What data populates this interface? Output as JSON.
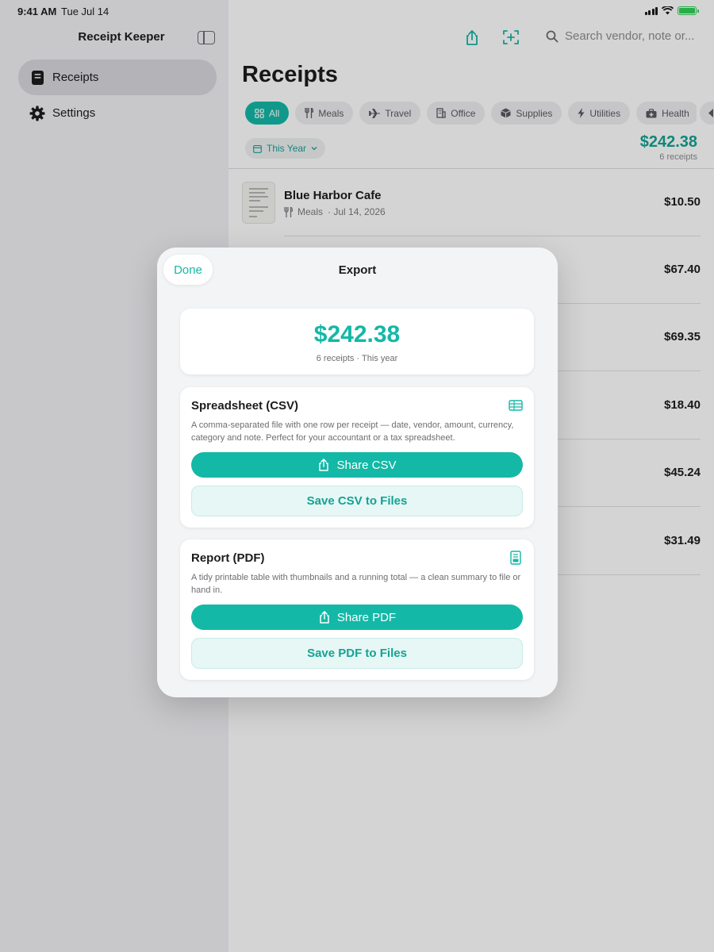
{
  "status": {
    "time": "9:41 AM",
    "date": "Tue Jul 14"
  },
  "sidebar": {
    "title": "Receipt Keeper",
    "items": [
      {
        "label": "Receipts",
        "icon": "receipt-icon",
        "active": true
      },
      {
        "label": "Settings",
        "icon": "gear-icon",
        "active": false
      }
    ]
  },
  "toolbar": {
    "search_placeholder": "Search vendor, note or..."
  },
  "main": {
    "title": "Receipts",
    "filters": [
      "All",
      "Meals",
      "Travel",
      "Office",
      "Supplies",
      "Utilities",
      "Health"
    ],
    "period": "This Year",
    "total": "$242.38",
    "total_count": "6 receipts",
    "receipts": [
      {
        "vendor": "Blue Harbor Cafe",
        "category": "Meals",
        "date": "· Jul 14, 2026",
        "amount": "$10.50"
      },
      {
        "vendor": "",
        "category": "",
        "date": "",
        "amount": "$67.40"
      },
      {
        "vendor": "",
        "category": "",
        "date": "",
        "amount": "$69.35"
      },
      {
        "vendor": "",
        "category": "",
        "date": "",
        "amount": "$18.40"
      },
      {
        "vendor": "",
        "category": "",
        "date": "",
        "amount": "$45.24"
      },
      {
        "vendor": "",
        "category": "",
        "date": "",
        "amount": "$31.49"
      }
    ]
  },
  "export_sheet": {
    "done_label": "Done",
    "title": "Export",
    "summary": {
      "amount": "$242.38",
      "subtitle": "6 receipts · This year"
    },
    "csv": {
      "title": "Spreadsheet (CSV)",
      "description": "A comma-separated file with one row per receipt — date, vendor, amount, currency, category and note. Perfect for your accountant or a tax spreadsheet.",
      "share_label": "Share CSV",
      "save_label": "Save CSV to Files"
    },
    "pdf": {
      "title": "Report (PDF)",
      "description": "A tidy printable table with thumbnails and a running total — a clean summary to file or hand in.",
      "share_label": "Share PDF",
      "save_label": "Save PDF to Files"
    }
  },
  "colors": {
    "accent": "#14b8a6",
    "accent_text": "#14a393",
    "accent_tint": "#e6f7f5"
  }
}
